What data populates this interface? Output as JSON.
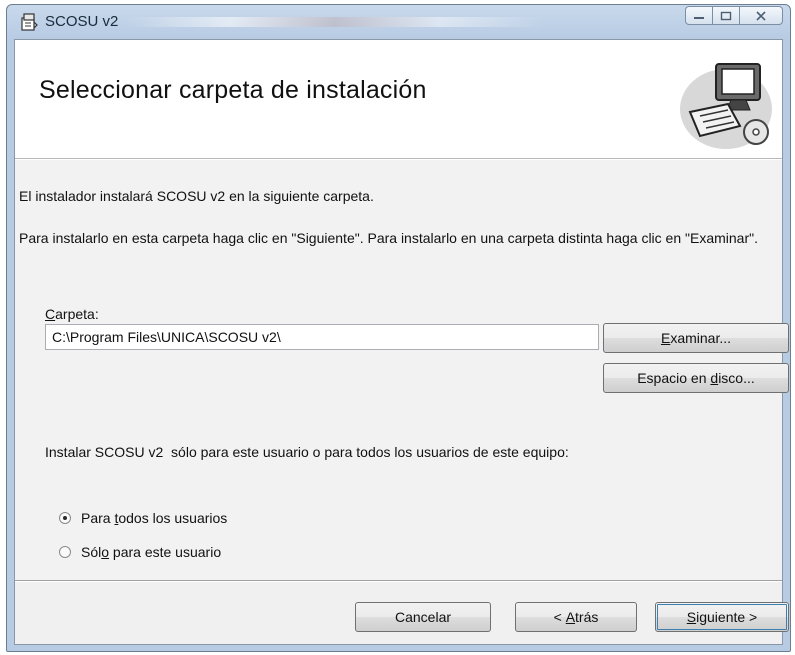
{
  "window": {
    "title": "SCOSU v2",
    "caption_icons": [
      "minimize-icon",
      "maximize-icon",
      "close-icon"
    ]
  },
  "banner": {
    "title": "Seleccionar carpeta de instalación"
  },
  "content": {
    "intro": "El instalador instalará SCOSU v2  en la siguiente carpeta.",
    "instructions": "Para instalarlo en esta carpeta haga clic en \"Siguiente\". Para instalarlo en una carpeta distinta haga clic en \"Examinar\".",
    "folder_label_first": "C",
    "folder_label_rest": "arpeta:",
    "folder_value": "C:\\Program Files\\UNICA\\SCOSU v2\\",
    "browse_first": "E",
    "browse_rest": "xaminar...",
    "disk_before": "Espacio en ",
    "disk_key": "d",
    "disk_after": "isco...",
    "install_for": "Instalar SCOSU v2  sólo para este usuario o para todos los usuarios de este equipo:",
    "radio_all_before": "Para ",
    "radio_all_key": "t",
    "radio_all_after": "odos los usuarios",
    "radio_all_selected": true,
    "radio_me_before": "Sól",
    "radio_me_key": "o",
    "radio_me_after": " para este usuario",
    "radio_me_selected": false
  },
  "footer": {
    "cancel": "Cancelar",
    "back_before": "< ",
    "back_key": "A",
    "back_after": "trás",
    "next_key": "S",
    "next_after": "iguiente >"
  }
}
